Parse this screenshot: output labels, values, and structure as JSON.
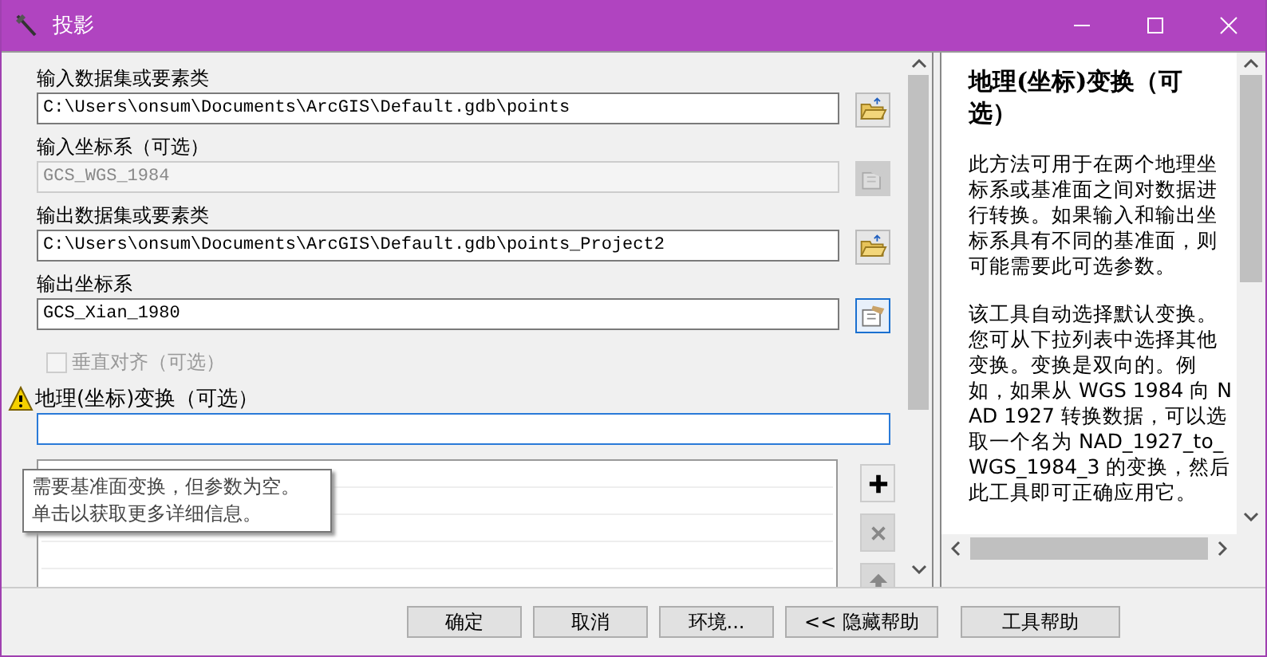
{
  "window": {
    "title": "投影"
  },
  "params": [
    {
      "kind": "path",
      "label": "输入数据集或要素类",
      "value": "C:\\Users\\onsum\\Documents\\ArcGIS\\Default.gdb\\points",
      "disabled": false
    },
    {
      "kind": "coord",
      "label": "输入坐标系（可选）",
      "value": "GCS_WGS_1984",
      "disabled": true
    },
    {
      "kind": "path",
      "label": "输出数据集或要素类",
      "value": "C:\\Users\\onsum\\Documents\\ArcGIS\\Default.gdb\\points_Project2",
      "disabled": false
    },
    {
      "kind": "coord",
      "label": "输出坐标系",
      "value": "GCS_Xian_1980",
      "disabled": false
    }
  ],
  "vertical": {
    "label": "垂直对齐（可选）",
    "checked": false,
    "disabled": true
  },
  "transform": {
    "label": "地理(坐标)变换（可选）",
    "warning": true
  },
  "tooltip": {
    "lines": [
      "需要基准面变换，但参数为空。",
      "单击以获取更多详细信息。"
    ]
  },
  "list_buttons": [
    {
      "kind": "add",
      "disabled": false
    },
    {
      "kind": "remove",
      "disabled": true
    },
    {
      "kind": "up",
      "disabled": true
    }
  ],
  "help": {
    "title": "地理(坐标)变换（可选）",
    "paragraphs": [
      "此方法可用于在两个地理坐标系或基准面之间对数据进行转换。如果输入和输出坐标系具有不同的基准面，则可能需要此可选参数。",
      "该工具自动选择默认变换。您可从下拉列表中选择其他变换。变换是双向的。例如，如果从 WGS 1984 向 NAD 1927 转换数据，可以选取一个名为 NAD_1927_to_WGS_1984_3 的变换，然后此工具即可正确应用它。"
    ]
  },
  "buttons": [
    "确定",
    "取消",
    "环境...",
    "<< 隐藏帮助",
    "工具帮助"
  ]
}
